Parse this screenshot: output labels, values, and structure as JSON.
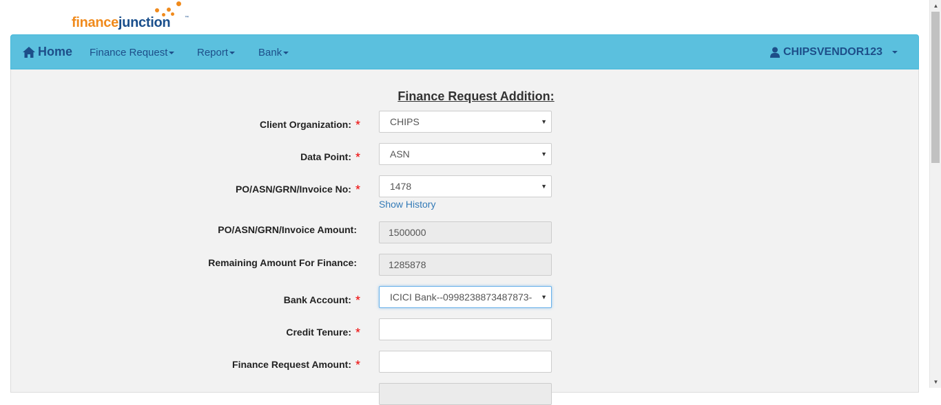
{
  "logo": {
    "part1": "finance",
    "part2": "junction",
    "tm": "™"
  },
  "nav": {
    "home": "Home",
    "items": [
      "Finance Request",
      "Report",
      "Bank"
    ],
    "user": "CHIPSVENDOR123"
  },
  "form": {
    "title": "Finance Request Addition:",
    "client_org": {
      "label": "Client Organization:",
      "value": "CHIPS"
    },
    "data_point": {
      "label": "Data Point:",
      "value": "ASN"
    },
    "doc_no": {
      "label": "PO/ASN/GRN/Invoice No:",
      "value": "1478",
      "link": "Show History"
    },
    "doc_amount": {
      "label": "PO/ASN/GRN/Invoice Amount:",
      "value": "1500000"
    },
    "remaining": {
      "label": "Remaining Amount For Finance:",
      "value": "1285878"
    },
    "bank_account": {
      "label": "Bank Account:",
      "value": "ICICI Bank--0998238873487873-"
    },
    "credit_tenure": {
      "label": "Credit Tenure:",
      "value": ""
    },
    "finance_amount": {
      "label": "Finance Request Amount:",
      "value": ""
    },
    "required_marker": "*",
    "dropdown_arrow": "▼"
  },
  "colors": {
    "navbar": "#5bc0de",
    "nav_text": "#1d4e89",
    "required": "#e00000",
    "link": "#337ab7"
  }
}
